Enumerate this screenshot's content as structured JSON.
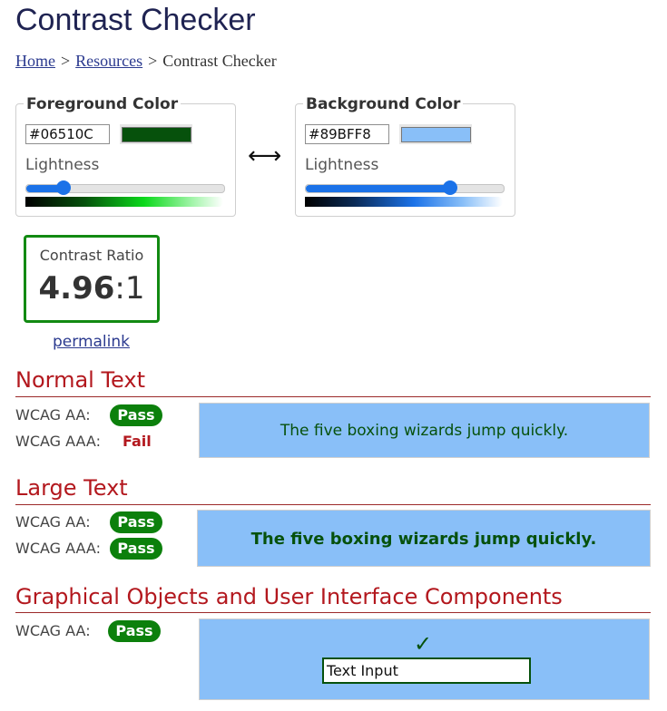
{
  "page": {
    "title": "Contrast Checker"
  },
  "breadcrumb": {
    "home": "Home",
    "resources": "Resources",
    "current": "Contrast Checker",
    "separator": ">"
  },
  "foreground": {
    "legend": "Foreground Color",
    "hex": "#06510C",
    "color": "#06510c",
    "lightness_label": "Lightness",
    "lightness_percent": 19
  },
  "background": {
    "legend": "Background Color",
    "hex": "#89BFF8",
    "color": "#89bff8",
    "lightness_label": "Lightness",
    "lightness_percent": 73
  },
  "swap_glyph": "⟷",
  "contrast": {
    "label": "Contrast Ratio",
    "ratio": "4.96",
    "suffix": ":1"
  },
  "permalink": "permalink",
  "sections": {
    "normal": {
      "title": "Normal Text",
      "aa_label": "WCAG AA:",
      "aa_result": "Pass",
      "aaa_label": "WCAG AAA:",
      "aaa_result": "Fail",
      "sample": "The five boxing wizards jump quickly."
    },
    "large": {
      "title": "Large Text",
      "aa_label": "WCAG AA:",
      "aa_result": "Pass",
      "aaa_label": "WCAG AAA:",
      "aaa_result": "Pass",
      "sample": "The five boxing wizards jump quickly."
    },
    "graphical": {
      "title": "Graphical Objects and User Interface Components",
      "aa_label": "WCAG AA:",
      "aa_result": "Pass",
      "check": "✓",
      "input_value": "Text Input"
    }
  },
  "colors": {
    "pass": "#0c800c",
    "fail": "#b3181e",
    "accent": "#1b72e8"
  }
}
